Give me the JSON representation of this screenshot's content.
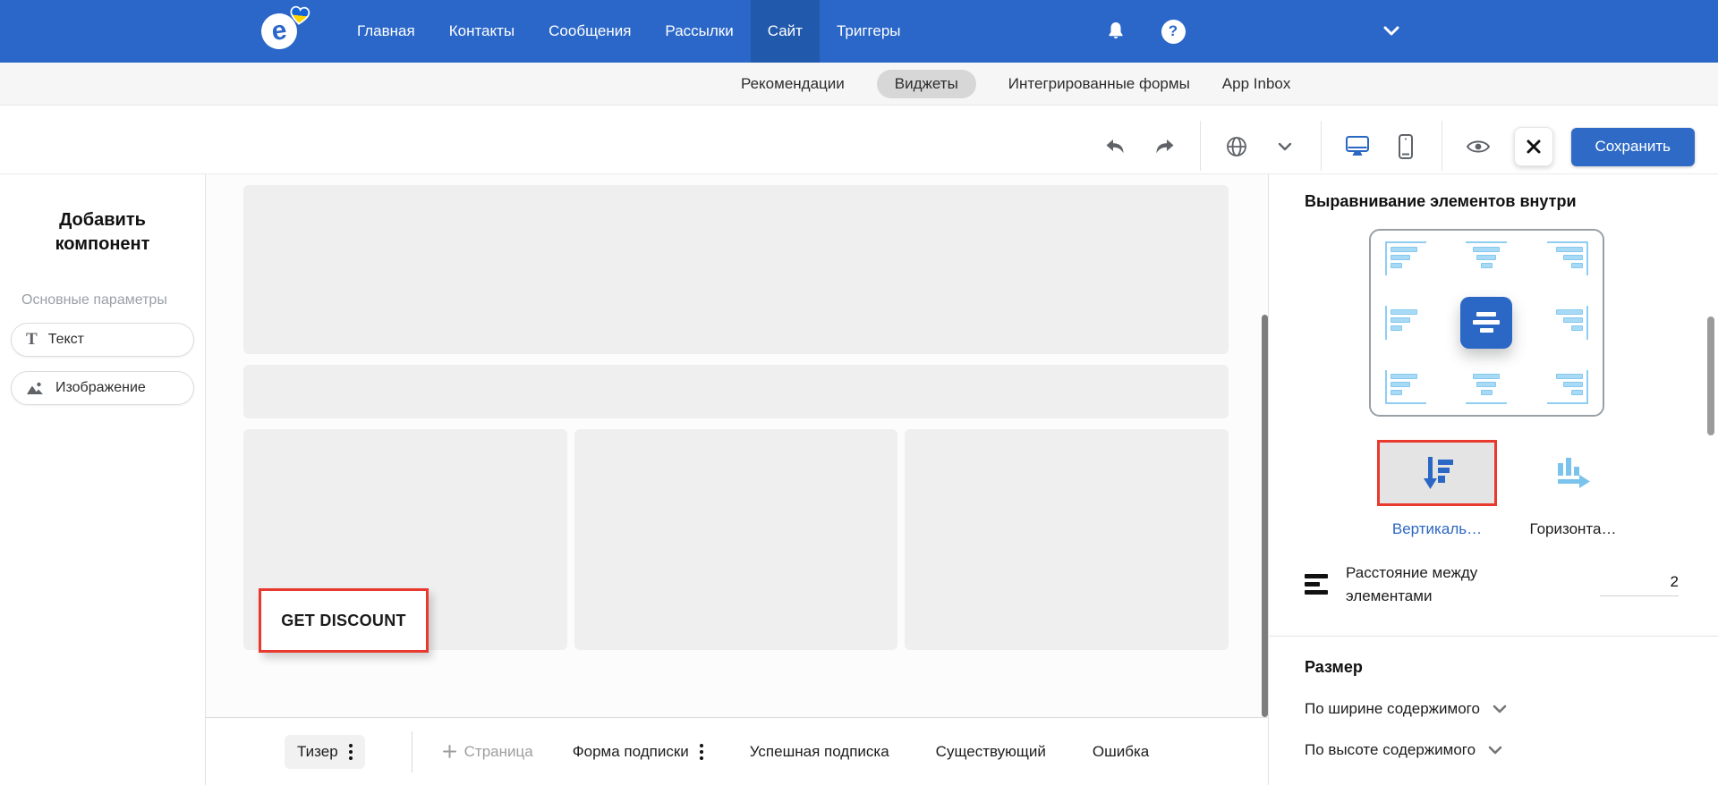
{
  "colors": {
    "nav_blue": "#2b67c8",
    "nav_active_blue": "#2159ac",
    "accent_blue": "#2b67c4",
    "annotation_red": "#e9392e",
    "alignment_light_blue": "#a9daf5",
    "placeholder_gray": "#efefef"
  },
  "nav": {
    "items": [
      {
        "label": "Главная"
      },
      {
        "label": "Контакты"
      },
      {
        "label": "Сообщения"
      },
      {
        "label": "Рассылки"
      },
      {
        "label": "Сайт"
      },
      {
        "label": "Триггеры"
      }
    ],
    "active": "Сайт",
    "icons": [
      "bell-icon",
      "help-icon",
      "chevron-down-icon"
    ]
  },
  "subnav": {
    "items": [
      {
        "label": "Рекомендации"
      },
      {
        "label": "Виджеты"
      },
      {
        "label": "Интегрированные формы"
      },
      {
        "label": "App Inbox"
      }
    ],
    "active": "Виджеты"
  },
  "toolbar": {
    "save_label": "Сохранить",
    "icons": [
      "undo-icon",
      "redo-icon",
      "globe-icon",
      "chevron-down-icon",
      "desktop-icon",
      "mobile-icon",
      "eye-icon",
      "close-icon"
    ],
    "active_device": "desktop"
  },
  "sidebar": {
    "title": "Добавить компонент",
    "section_label": "Основные параметры",
    "components": [
      {
        "label": "Текст",
        "icon": "text-icon"
      },
      {
        "label": "Изображение",
        "icon": "image-icon"
      }
    ]
  },
  "canvas": {
    "cta_label": "GET DISCOUNT"
  },
  "inspector": {
    "alignment_title": "Выравнивание элементов внутри",
    "vertical_label": "Вертикаль…",
    "horizontal_label": "Горизонта…",
    "selected_layout": "vertical",
    "spacing_label": "Расстояние между элементами",
    "spacing_value": "2",
    "size_title": "Размер",
    "width_option": "По ширине содержимого",
    "height_option": "По высоте содержимого"
  },
  "bottombar": {
    "teaser": "Тизер",
    "add_page": "Страница",
    "form": "Форма подписки",
    "success": "Успешная подписка",
    "existing": "Существующий",
    "error": "Ошибка"
  }
}
